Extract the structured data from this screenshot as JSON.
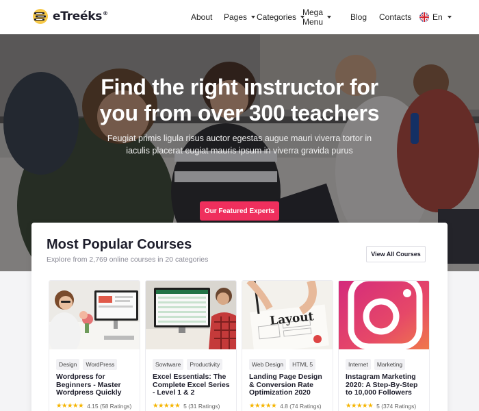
{
  "nav": {
    "logo_text": "eTreéks",
    "logo_reg": "®",
    "items": [
      {
        "label": "About"
      },
      {
        "label": "Pages"
      },
      {
        "label": "Categories"
      },
      {
        "label": "Mega Menu"
      },
      {
        "label": "Blog"
      },
      {
        "label": "Contacts"
      }
    ],
    "language": "En"
  },
  "hero": {
    "title_line1": "Find the right instructor for",
    "title_line2": "you from over 300 teachers",
    "subtitle": "Feugiat primis ligula risus auctor egestas augue mauri viverra tortor in iaculis placerat eugiat mauris ipsum in viverra gravida purus",
    "cta_label": "Our Featured Experts",
    "cta_color": "#ef2f5d"
  },
  "courses": {
    "title": "Most Popular Courses",
    "subtitle": "Explore from 2,769 online courses in 20 categories",
    "view_all_label": "View All Courses",
    "items": [
      {
        "tags": [
          "Design",
          "WordPress"
        ],
        "title": "Wordpress for Beginners - Master Wordpress Quickly",
        "rating": "4.15",
        "ratings_count": "(58 Ratings)",
        "stars": 4.15
      },
      {
        "tags": [
          "Sowtware",
          "Productivity"
        ],
        "title": "Excel Essentials: The Complete Excel Series - Level 1 & 2",
        "rating": "5",
        "ratings_count": "(31 Ratings)",
        "stars": 5
      },
      {
        "tags": [
          "Web Design",
          "HTML 5"
        ],
        "title": "Landing Page Design & Conversion Rate Optimization 2020",
        "rating": "4.8",
        "ratings_count": "(74 Ratings)",
        "stars": 4.8
      },
      {
        "tags": [
          "Internet",
          "Marketing"
        ],
        "title": "Instagram Marketing 2020: A Step-By-Step to 10,000 Followers",
        "rating": "5",
        "ratings_count": "(374 Ratings)",
        "stars": 5
      }
    ],
    "image_texts": {
      "layout_sketch": "Layout"
    }
  }
}
